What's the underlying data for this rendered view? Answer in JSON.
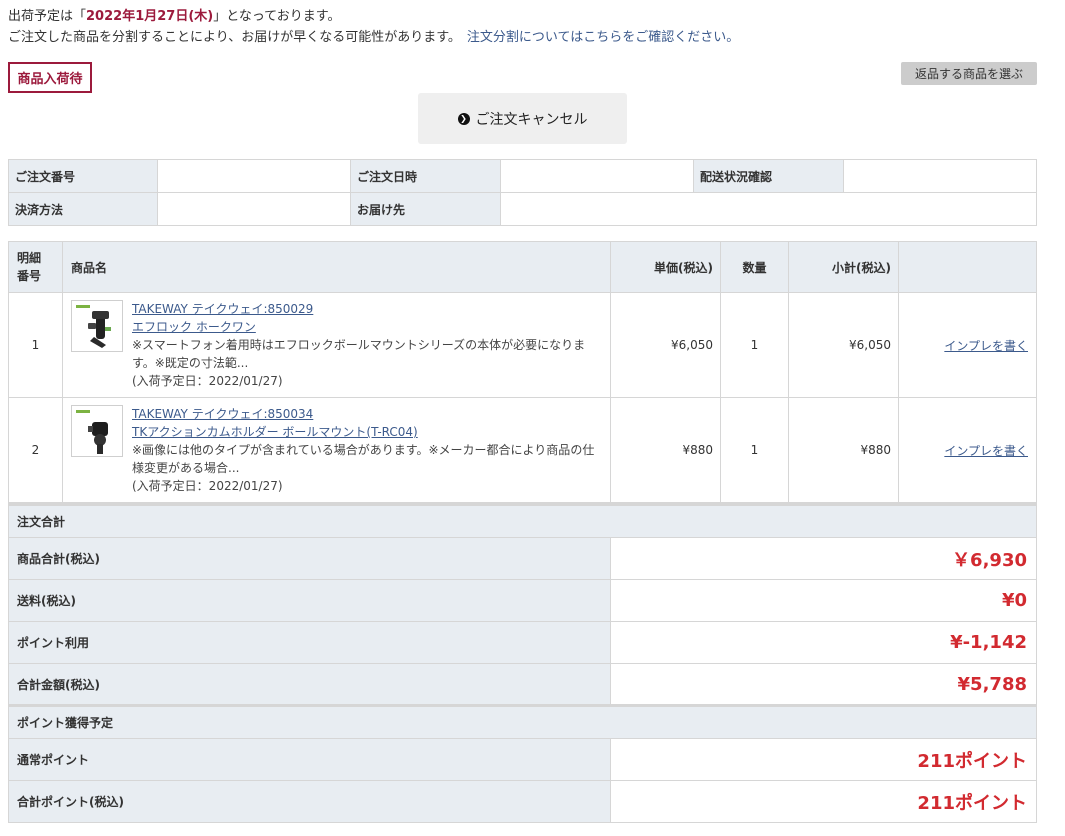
{
  "notice": {
    "line1_prefix": "出荷予定は「",
    "line1_date": "2022年1月27日(木)",
    "line1_suffix": "」となっております。",
    "line2_text": "ご注文した商品を分割することにより、お届けが早くなる可能性があります。",
    "line2_link": "注文分割についてはこちらをご確認ください。"
  },
  "status_tag": "商品入荷待",
  "return_button": "返品する商品を選ぶ",
  "cancel_button": "ご注文キャンセル",
  "info": {
    "order_number_label": "ご注文番号",
    "order_number": "",
    "order_date_label": "ご注文日時",
    "order_date": "",
    "shipping_status_label": "配送状況確認",
    "shipping_status": "",
    "payment_label": "決済方法",
    "payment": "",
    "destination_label": "お届け先",
    "destination": ""
  },
  "items_table": {
    "headers": {
      "line_no": "明細\n番号",
      "product": "商品名",
      "unit_price": "単価(税込)",
      "qty": "数量",
      "subtotal": "小計(税込)"
    },
    "rows": [
      {
        "no": "1",
        "title": "TAKEWAY テイクウェイ:850029",
        "subtitle": "エフロック ホークワン",
        "desc": "※スマートフォン着用時はエフロックボールマウントシリーズの本体が必要になります。※既定の寸法範...",
        "arrival": "(入荷予定日：2022/01/27)",
        "unit_price": "¥6,050",
        "qty": "1",
        "subtotal": "¥6,050",
        "review": "インプレを書く"
      },
      {
        "no": "2",
        "title": "TAKEWAY テイクウェイ:850034",
        "subtitle": "TKアクションカムホルダー ボールマウント(T-RC04)",
        "desc": "※画像には他のタイプが含まれている場合があります。※メーカー都合により商品の仕様変更がある場合...",
        "arrival": "(入荷予定日：2022/01/27)",
        "unit_price": "¥880",
        "qty": "1",
        "subtotal": "¥880",
        "review": "インプレを書く"
      }
    ]
  },
  "summary": {
    "order_total_heading": "注文合計",
    "product_total_label": "商品合計(税込)",
    "product_total": "￥6,930",
    "shipping_label": "送料(税込)",
    "shipping": "¥0",
    "points_used_label": "ポイント利用",
    "points_used": "¥-1,142",
    "grand_total_label": "合計金額(税込)",
    "grand_total": "¥5,788",
    "points_heading": "ポイント獲得予定",
    "normal_points_label": "通常ポイント",
    "normal_points": "211ポイント",
    "total_points_label": "合計ポイント(税込)",
    "total_points": "211ポイント"
  },
  "colors": {
    "accent": "#9c1a3c",
    "price_red": "#d22a30",
    "link": "#3c5a8c",
    "header_bg": "#e8edf2"
  }
}
